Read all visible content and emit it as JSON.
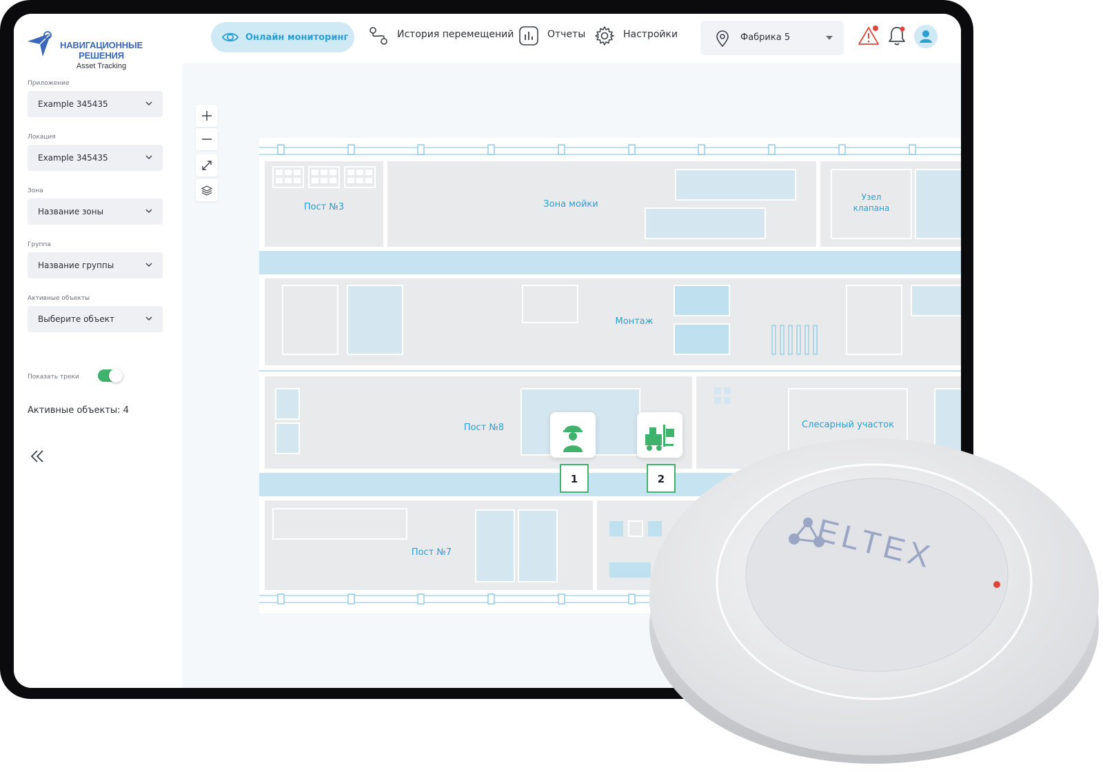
{
  "brand": {
    "line1": "НАВИГАЦИОННЫЕ",
    "line2": "РЕШЕНИЯ",
    "sub": "Asset Tracking"
  },
  "filters": [
    {
      "label": "Приложение",
      "value": "Example 345435"
    },
    {
      "label": "Локация",
      "value": "Example 345435"
    },
    {
      "label": "Зона",
      "value": "Название зоны"
    },
    {
      "label": "Группа",
      "value": "Название группы"
    },
    {
      "label": "Активные объекты",
      "value": "Выберите объект"
    }
  ],
  "toggle": {
    "label": "Показать треки",
    "on": true
  },
  "active_count": "Активные объекты: 4",
  "nav": {
    "online": "Онлайн мониторинг",
    "history": "История перемещений",
    "reports": "Отчеты",
    "settings": "Настройки"
  },
  "factory": "Фабрика 5",
  "zones": {
    "post3": "Пост №3",
    "wash": "Зона мойки",
    "valve_line1": "Узел",
    "valve_line2": "клапана",
    "assembly": "Монтаж",
    "post8": "Пост №8",
    "locksmith": "Слесарный участок",
    "post7": "Пост №7"
  },
  "markers": [
    {
      "label": "1",
      "icon": "worker-icon"
    },
    {
      "label": "2",
      "icon": "forklift-icon"
    }
  ],
  "device_brand": "ELTEX",
  "colors": {
    "accent": "#2a9fd0",
    "pill": "#cfe9f5",
    "zone": "#e9eaec",
    "block": "#d4e6ef",
    "corridor": "#c5e3f0",
    "marker_green": "#3fb36b",
    "alert": "#e0463c"
  }
}
